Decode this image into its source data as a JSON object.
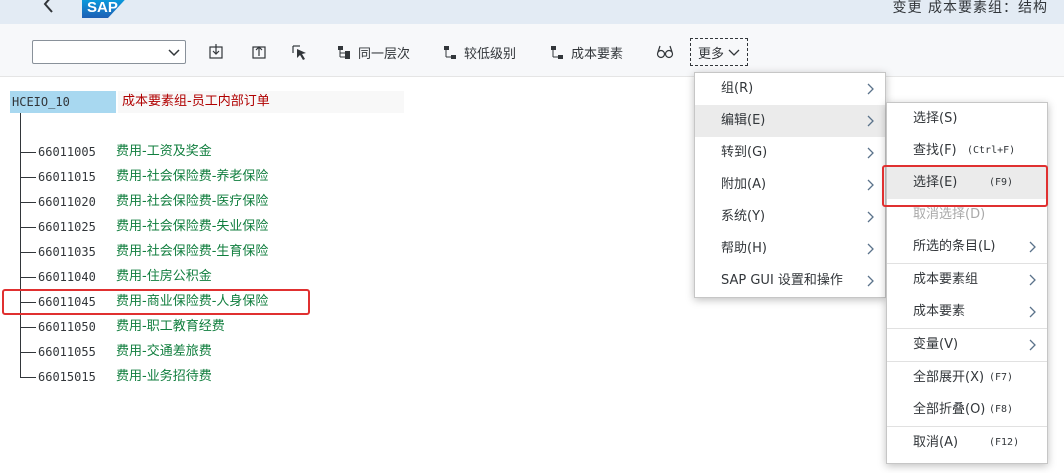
{
  "shell": {
    "title": "变更 成本要素组：结构",
    "logo_text": "SAP"
  },
  "toolbar": {
    "select_value": "",
    "same_level_label": "同一层次",
    "lower_level_label": "较低级别",
    "cost_element_label": "成本要素",
    "more_label": "更多"
  },
  "tree": {
    "root_code": "HCEIO_10",
    "root_name": "成本要素组-员工内部订单",
    "items": [
      {
        "code": "66011005",
        "name": "费用-工资及奖金"
      },
      {
        "code": "66011015",
        "name": "费用-社会保险费-养老保险"
      },
      {
        "code": "66011020",
        "name": "费用-社会保险费-医疗保险"
      },
      {
        "code": "66011025",
        "name": "费用-社会保险费-失业保险"
      },
      {
        "code": "66011035",
        "name": "费用-社会保险费-生育保险"
      },
      {
        "code": "66011040",
        "name": "费用-住房公积金"
      },
      {
        "code": "66011045",
        "name": "费用-商业保险费-人身保险"
      },
      {
        "code": "66011050",
        "name": "费用-职工教育经费"
      },
      {
        "code": "66011055",
        "name": "费用-交通差旅费"
      },
      {
        "code": "66015015",
        "name": "费用-业务招待费"
      }
    ]
  },
  "menu": {
    "items": [
      {
        "label": "组(R)"
      },
      {
        "label": "编辑(E)"
      },
      {
        "label": "转到(G)"
      },
      {
        "label": "附加(A)"
      },
      {
        "label": "系统(Y)"
      },
      {
        "label": "帮助(H)"
      },
      {
        "label": "SAP GUI 设置和操作"
      }
    ]
  },
  "submenu": {
    "items": [
      {
        "label": "选择(S)",
        "shortcut": ""
      },
      {
        "label": "查找(F)",
        "shortcut": "(Ctrl+F)"
      },
      {
        "label": "选择(E)",
        "shortcut": "(F9)"
      },
      {
        "label": "取消选择(D)",
        "shortcut": ""
      },
      {
        "label": "所选的条目(L)",
        "shortcut": ""
      },
      {
        "label": "成本要素组",
        "shortcut": ""
      },
      {
        "label": "成本要素",
        "shortcut": ""
      },
      {
        "label": "变量(V)",
        "shortcut": ""
      },
      {
        "label": "全部展开(X)",
        "shortcut": "(F7)"
      },
      {
        "label": "全部折叠(O)",
        "shortcut": "(F8)"
      },
      {
        "label": "取消(A)",
        "shortcut": "(F12)"
      }
    ]
  },
  "colors": {
    "accent": "#0a6ed1",
    "highlight_border": "#e03030",
    "tree_name": "#107e3e",
    "root_name": "#b00000",
    "root_code_bg": "#a8d8f0"
  },
  "icons": [
    "back-arrow-icon",
    "chevron-down-icon",
    "expand-icon",
    "collapse-icon",
    "cursor-select-icon",
    "hierarchy-icon",
    "glasses-icon",
    "chevron-right-icon"
  ]
}
